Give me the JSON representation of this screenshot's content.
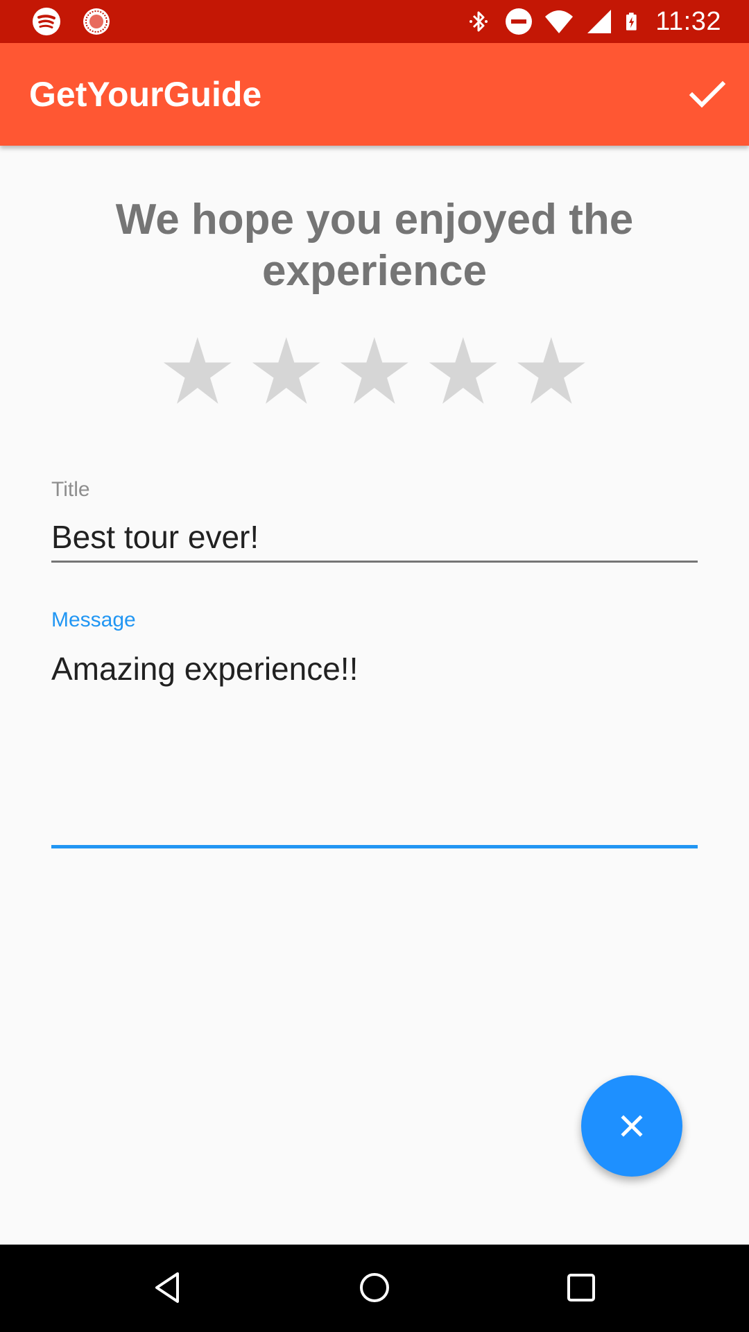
{
  "status_bar": {
    "time": "11:32",
    "icons": [
      "spotify-icon",
      "rec-icon",
      "bluetooth-icon",
      "do-not-disturb-icon",
      "wifi-icon",
      "signal-icon",
      "battery-charging-icon"
    ],
    "background": "#c41705"
  },
  "app_bar": {
    "title": "GetYourGuide",
    "action_icon": "check-icon",
    "background": "#ff5733"
  },
  "review": {
    "heading": "We hope you enjoyed the experience",
    "rating": 0,
    "max_rating": 5,
    "star_color": "#d6d6d6"
  },
  "form": {
    "title": {
      "label": "Title",
      "value": "Best tour ever!"
    },
    "message": {
      "label": "Message",
      "value": "Amazing experience!!"
    },
    "accent": "#2196f3"
  },
  "fab": {
    "icon": "close-icon",
    "color": "#1e90ff"
  },
  "nav_bar": {
    "icons": [
      "back-icon",
      "home-icon",
      "recents-icon"
    ]
  }
}
